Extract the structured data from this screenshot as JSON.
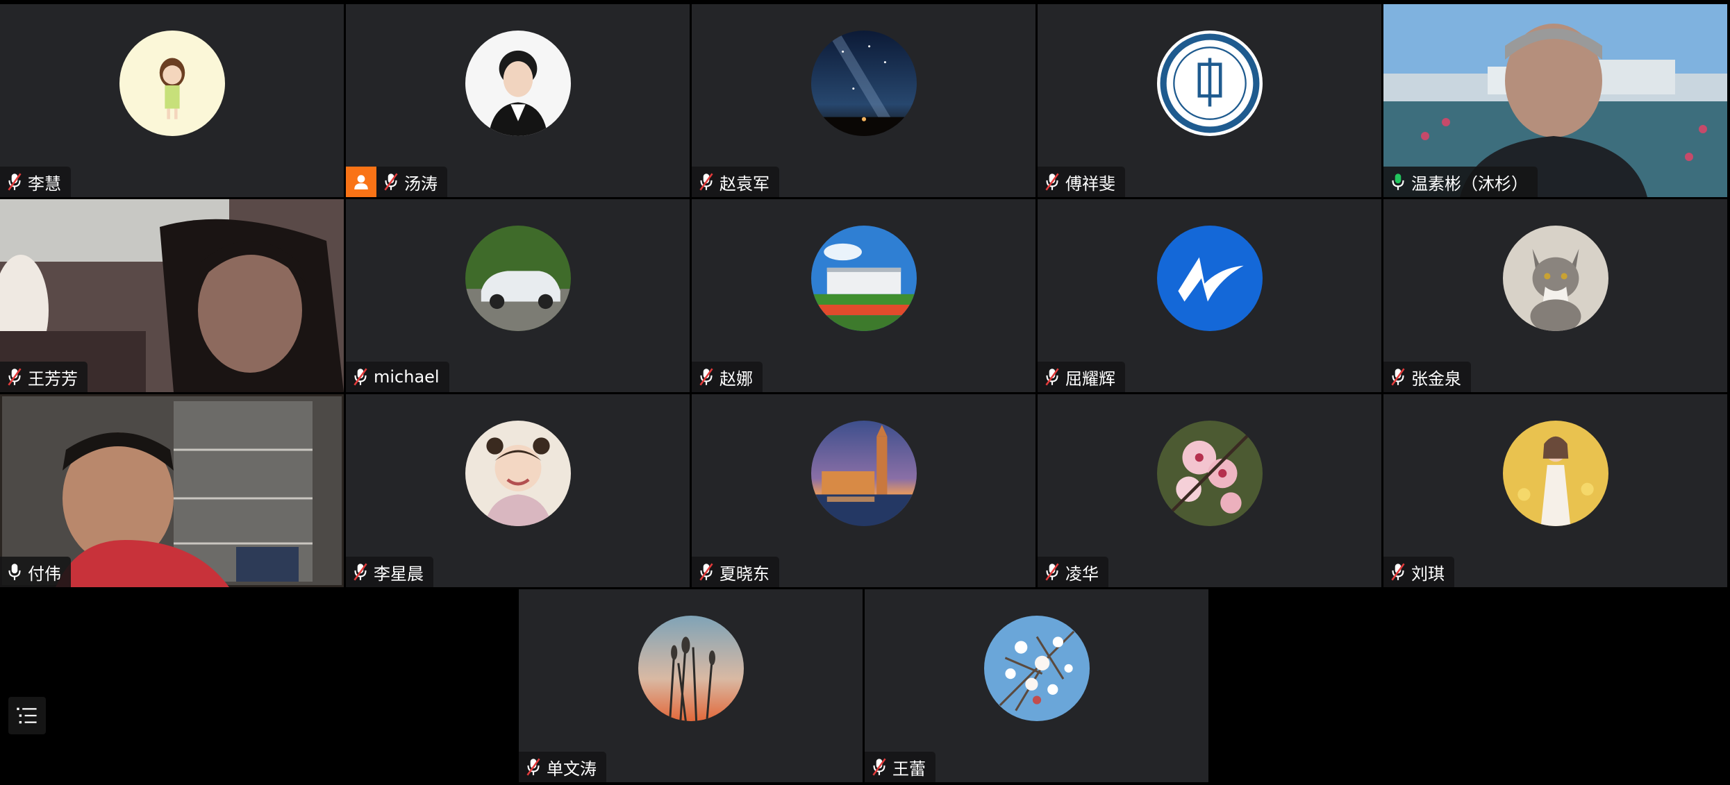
{
  "participants": [
    {
      "name": "李慧",
      "mic": "muted"
    },
    {
      "name": "汤涛",
      "mic": "muted",
      "host": true
    },
    {
      "name": "赵袁军",
      "mic": "muted"
    },
    {
      "name": "傅祥斐",
      "mic": "muted"
    },
    {
      "name": "温素彬（沐杉）",
      "mic": "speaking",
      "active_speaker": true,
      "video": true
    },
    {
      "name": "王芳芳",
      "mic": "muted",
      "video": true
    },
    {
      "name": "michael",
      "mic": "muted"
    },
    {
      "name": "赵娜",
      "mic": "muted"
    },
    {
      "name": "屈耀辉",
      "mic": "muted"
    },
    {
      "name": "张金泉",
      "mic": "muted"
    },
    {
      "name": "付伟",
      "mic": "unmuted",
      "video": true
    },
    {
      "name": "李星晨",
      "mic": "muted"
    },
    {
      "name": "夏晓东",
      "mic": "muted"
    },
    {
      "name": "凌华",
      "mic": "muted"
    },
    {
      "name": "刘琪",
      "mic": "muted"
    },
    {
      "name": "单文涛",
      "mic": "muted"
    },
    {
      "name": "王蕾",
      "mic": "muted"
    }
  ],
  "colors": {
    "tile_bg": "#242528",
    "active_speaker_border": "#22c55e",
    "host_badge": "#f97316",
    "muted_icon": "#ffffff",
    "muted_slash": "#e23b3b",
    "speaking_icon": "#22c55e"
  },
  "icons": {
    "muted": "microphone-muted-icon",
    "unmuted": "microphone-icon",
    "host": "host-person-icon",
    "menu": "list-menu-icon"
  }
}
